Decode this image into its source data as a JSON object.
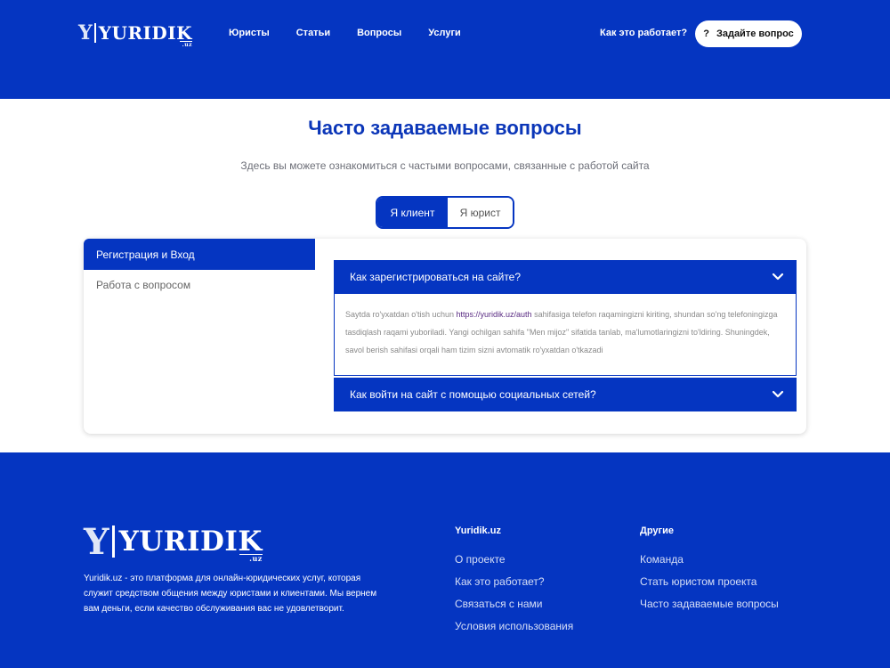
{
  "header": {
    "logo_text": "YURIDIK",
    "logo_letter": "Y",
    "logo_suffix": ".uz",
    "nav": [
      "Юристы",
      "Статьи",
      "Вопросы",
      "Услуги"
    ],
    "how_it_works": "Как это работает?",
    "ask_button": "Задайте вопрос",
    "ask_icon": "?"
  },
  "main": {
    "title": "Часто задаваемые вопросы",
    "subtitle": "Здесь вы можете ознакомиться с частыми вопросами, связанные с работой сайта",
    "toggle": {
      "client": "Я клиент",
      "lawyer": "Я юрист",
      "selected": "client"
    },
    "sidebar": [
      "Регистрация и Вход",
      "Работа с вопросом"
    ],
    "faq": [
      {
        "question": "Как зарегистрироваться на сайте?",
        "expanded": true,
        "answer_before": "Saytda ro'yxatdan o'tish uchun ",
        "answer_link": "https://yuridik.uz/auth",
        "answer_after": " sahifasiga telefon raqamingizni kiriting, shundan so'ng telefoningizga tasdiqlash raqami yuboriladi. Yangi ochilgan sahifa \"Men mijoz\" sifatida tanlab, ma'lumotlaringizni to'ldiring. Shuningdek, savol berish sahifasi orqali ham tizim sizni avtomatik ro'yxatdan o'tkazadi"
      },
      {
        "question": "Как войти на сайт с помощью социальных сетей?",
        "expanded": false
      }
    ]
  },
  "footer": {
    "logo_text": "YURIDIK",
    "logo_letter": "Y",
    "logo_suffix": ".uz",
    "description": "Yuridik.uz - это платформа для онлайн-юридических услуг, которая служит средством общения между юристами и клиентами. Мы вернем вам деньги, если качество обслуживания вас не удовлетворит.",
    "col1": {
      "title": "Yuridik.uz",
      "links": [
        "О проекте",
        "Как это работает?",
        "Связаться с нами",
        "Условия использования"
      ]
    },
    "col2": {
      "title": "Другие",
      "links": [
        "Команда",
        "Стать юристом проекта",
        "Часто задаваемые вопросы"
      ]
    }
  },
  "colors": {
    "brand": "#0535c1",
    "title": "#0b36b8",
    "link": "#5a2c83"
  }
}
